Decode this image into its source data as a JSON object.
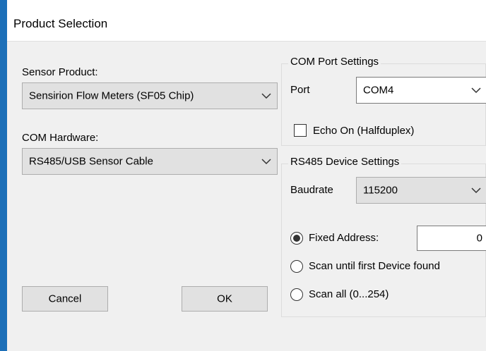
{
  "window": {
    "title": "Product Selection"
  },
  "left": {
    "sensor_product_label": "Sensor Product:",
    "sensor_product_value": "Sensirion Flow Meters (SF05 Chip)",
    "com_hardware_label": "COM Hardware:",
    "com_hardware_value": "RS485/USB Sensor Cable"
  },
  "com_port_settings": {
    "legend": "COM Port Settings",
    "port_label": "Port",
    "port_value": "COM4",
    "echo_label": "Echo On (Halfduplex)",
    "echo_checked": false
  },
  "rs485_settings": {
    "legend": "RS485 Device Settings",
    "baudrate_label": "Baudrate",
    "baudrate_value": "115200",
    "fixed_address_label": "Fixed Address:",
    "fixed_address_value": "0",
    "scan_first_label": "Scan until first Device found",
    "scan_all_label": "Scan all (0...254)",
    "selected": "fixed_address"
  },
  "buttons": {
    "cancel": "Cancel",
    "ok": "OK"
  },
  "colors": {
    "desktop": "#1c6fb8",
    "window": "#f0f0f0",
    "combo": "#e1e1e1"
  }
}
